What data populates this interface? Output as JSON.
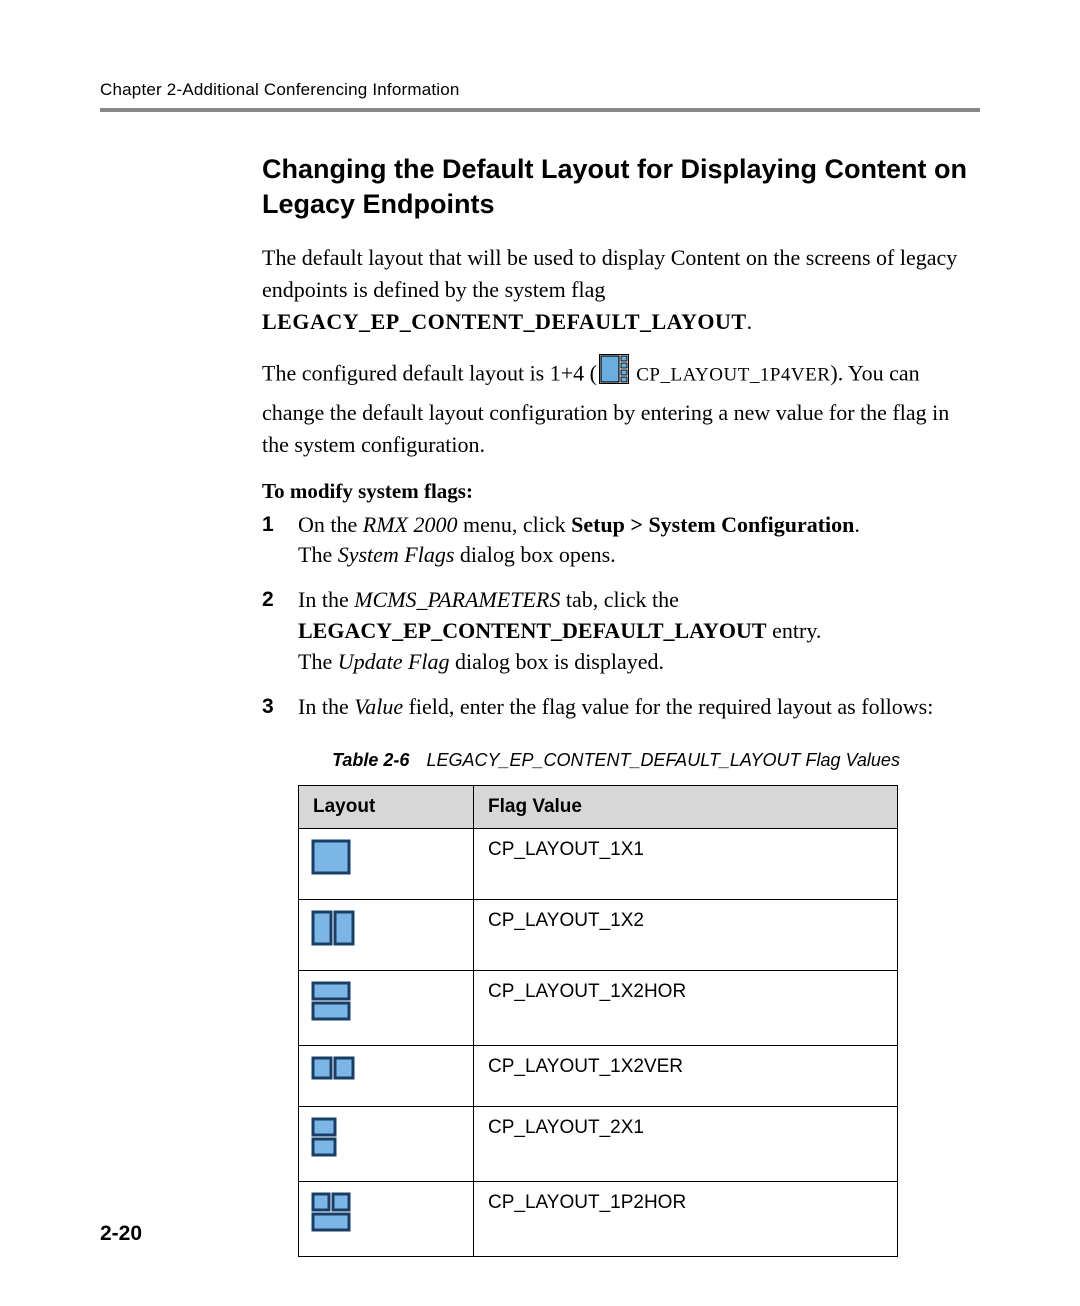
{
  "header": {
    "running_head": "Chapter 2-Additional Conferencing Information"
  },
  "title": "Changing the Default Layout for Displaying Content on Legacy Endpoints",
  "para1_a": "The default layout that will be used to display Content on the screens of legacy endpoints is defined by the system flag ",
  "para1_flag": "LEGACY_EP_CONTENT_DEFAULT_LAYOUT",
  "para1_b": ".",
  "config_a": "The configured default layout is 1+4 (",
  "config_code": " CP_LAYOUT_1P4VER",
  "config_b": "). You can change the default layout configuration by entering a new value for the flag in the system configuration.",
  "subhead": "To modify system flags:",
  "steps": {
    "s1a": "On the ",
    "s1b": "RMX 2000",
    "s1c": " menu, click ",
    "s1d": "Setup > System Configuration",
    "s1e": ".",
    "s1f": "The ",
    "s1g": "System Flags",
    "s1h": " dialog box opens.",
    "s2a": "In the ",
    "s2b": "MCMS_PARAMETERS",
    "s2c": " tab, click the ",
    "s2d": "LEGACY_EP_CONTENT_DEFAULT_LAYOUT",
    "s2e": " entry.",
    "s2f": "The ",
    "s2g": "Update Flag",
    "s2h": " dialog box is displayed.",
    "s3a": "In the ",
    "s3b": "Value",
    "s3c": " field, enter the flag value for the required layout as follows:"
  },
  "caption": {
    "label": "Table 2-6",
    "text": "LEGACY_EP_CONTENT_DEFAULT_LAYOUT Flag Values"
  },
  "table": {
    "h1": "Layout",
    "h2": "Flag Value",
    "rows": [
      {
        "layout": "1x1",
        "value": "CP_LAYOUT_1X1"
      },
      {
        "layout": "1x2",
        "value": "CP_LAYOUT_1X2"
      },
      {
        "layout": "1x2hor",
        "value": "CP_LAYOUT_1X2HOR"
      },
      {
        "layout": "1x2ver",
        "value": "CP_LAYOUT_1X2VER"
      },
      {
        "layout": "2x1",
        "value": "CP_LAYOUT_2X1"
      },
      {
        "layout": "1p2hor",
        "value": "CP_LAYOUT_1P2HOR"
      }
    ]
  },
  "page_number": "2-20"
}
